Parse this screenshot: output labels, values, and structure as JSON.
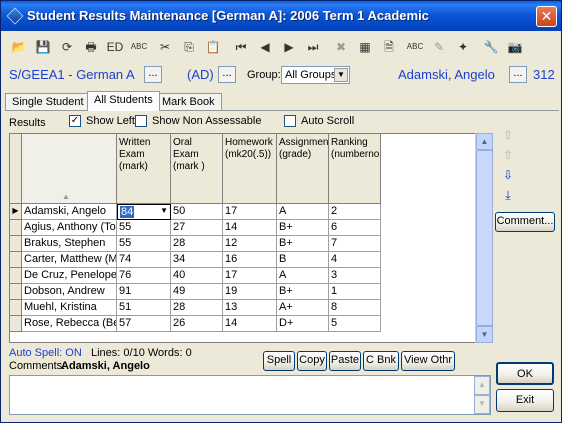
{
  "window": {
    "title": "Student Results Maintenance  [German A]:  2006 Term 1 Academic",
    "close_glyph": "✕"
  },
  "toolbar": {
    "icons": [
      {
        "name": "open-folder-icon",
        "glyph": "📂",
        "enabled": true
      },
      {
        "name": "save-icon",
        "glyph": "💾",
        "enabled": false
      },
      {
        "name": "refresh-icon",
        "glyph": "⟳",
        "enabled": true
      },
      {
        "name": "print-icon",
        "glyph": "🖶",
        "enabled": true
      },
      {
        "name": "edit-icon",
        "glyph": "ED",
        "enabled": true
      },
      {
        "name": "spellcheck-icon",
        "glyph": "ABC",
        "enabled": true
      },
      {
        "name": "cut-icon",
        "glyph": "✂",
        "enabled": true
      },
      {
        "name": "copy-icon",
        "glyph": "⎘",
        "enabled": true
      },
      {
        "name": "paste-icon",
        "glyph": "📋",
        "enabled": true
      },
      {
        "name": "first-record-icon",
        "glyph": "⏮",
        "enabled": true
      },
      {
        "name": "previous-record-icon",
        "glyph": "◀",
        "enabled": true
      },
      {
        "name": "next-record-icon",
        "glyph": "▶",
        "enabled": true
      },
      {
        "name": "last-record-icon",
        "glyph": "⏭",
        "enabled": true
      },
      {
        "name": "delete-icon",
        "glyph": "✖",
        "enabled": false
      },
      {
        "name": "grid-options-icon",
        "glyph": "▦",
        "enabled": true
      },
      {
        "name": "page-icon",
        "glyph": "🗎",
        "enabled": true
      },
      {
        "name": "spell-assist-icon",
        "glyph": "ABC",
        "enabled": true
      },
      {
        "name": "tool-disabled-icon",
        "glyph": "✎",
        "enabled": false
      },
      {
        "name": "wand-icon",
        "glyph": "✦",
        "enabled": true
      },
      {
        "name": "tools-icon",
        "glyph": "🔧",
        "enabled": false
      },
      {
        "name": "camera-icon",
        "glyph": "📷",
        "enabled": true
      }
    ]
  },
  "context": {
    "class_code": "S/GEEA1 - German A",
    "dots": "...",
    "ad_label": "(AD)",
    "group_label": "Group:",
    "group_value": "All Groups",
    "student_name": "Adamski, Angelo",
    "room": "312"
  },
  "tabs": [
    {
      "label": "Single Student",
      "active": false
    },
    {
      "label": "All Students",
      "active": true
    },
    {
      "label": "Mark Book",
      "active": false
    }
  ],
  "options": {
    "results_label": "Results",
    "show_left": {
      "label": "Show Left",
      "checked": true
    },
    "show_non_assessable": {
      "label": "Show Non Assessable",
      "checked": false
    },
    "auto_scroll": {
      "label": "Auto Scroll",
      "checked": false
    }
  },
  "grid": {
    "columns": [
      {
        "key": "name",
        "label": ""
      },
      {
        "key": "written",
        "label": "Written Exam (mark)"
      },
      {
        "key": "oral",
        "label": "Oral Exam (mark )"
      },
      {
        "key": "homework",
        "label": "Homework (mk20(.5))"
      },
      {
        "key": "assignment",
        "label": "Assignment (grade)"
      },
      {
        "key": "ranking",
        "label": "Ranking (numbernomask)"
      }
    ],
    "rows": [
      {
        "name": "Adamski, Angelo",
        "written": "84",
        "oral": "50",
        "homework": "17",
        "assignment": "A",
        "ranking": "2",
        "current": true
      },
      {
        "name": "Agius, Anthony (Tony)",
        "written": "55",
        "oral": "27",
        "homework": "14",
        "assignment": "B+",
        "ranking": "6"
      },
      {
        "name": "Brakus, Stephen",
        "written": "55",
        "oral": "28",
        "homework": "12",
        "assignment": "B+",
        "ranking": "7"
      },
      {
        "name": "Carter, Matthew (Matt)",
        "written": "74",
        "oral": "34",
        "homework": "16",
        "assignment": "B",
        "ranking": "4"
      },
      {
        "name": "De Cruz, Penelope",
        "written": "76",
        "oral": "40",
        "homework": "17",
        "assignment": "A",
        "ranking": "3"
      },
      {
        "name": "Dobson, Andrew",
        "written": "91",
        "oral": "49",
        "homework": "19",
        "assignment": "B+",
        "ranking": "1"
      },
      {
        "name": "Muehl, Kristina",
        "written": "51",
        "oral": "28",
        "homework": "13",
        "assignment": "A+",
        "ranking": "8"
      },
      {
        "name": "Rose, Rebecca (Becky)",
        "written": "57",
        "oral": "26",
        "homework": "14",
        "assignment": "D+",
        "ranking": "5"
      }
    ]
  },
  "side": {
    "comment_button": "Comment..."
  },
  "status": {
    "auto_spell": "Auto Spell: ON",
    "counts": "Lines: 0/10 Words: 0",
    "comments_label": "Comments:",
    "comments_student": "Adamski, Angelo"
  },
  "comment_buttons": [
    {
      "label": "Spell"
    },
    {
      "label": "Copy"
    },
    {
      "label": "Paste"
    },
    {
      "label": "C Bnk"
    },
    {
      "label": "View Othr"
    }
  ],
  "dialog_buttons": {
    "ok": "OK",
    "exit": "Exit"
  },
  "colors": {
    "title_bar": "#0b56d8",
    "link_blue": "#1c3fd0",
    "window_face": "#ece9d8"
  }
}
